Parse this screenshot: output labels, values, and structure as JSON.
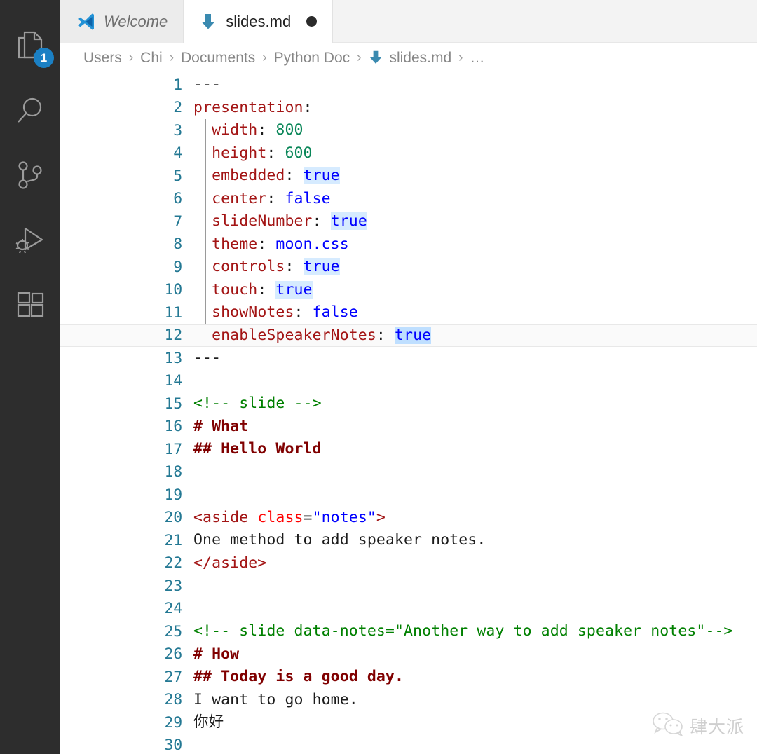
{
  "activity_bar": {
    "items": [
      {
        "name": "explorer",
        "icon": "files-icon",
        "badge": "1"
      },
      {
        "name": "search",
        "icon": "search-icon",
        "badge": null
      },
      {
        "name": "source-control",
        "icon": "source-control-icon",
        "badge": null
      },
      {
        "name": "run-and-debug",
        "icon": "run-debug-icon",
        "badge": null
      },
      {
        "name": "extensions",
        "icon": "extensions-icon",
        "badge": null
      }
    ]
  },
  "tabs": [
    {
      "label": "Welcome",
      "icon": "vscode-logo-icon",
      "active": false,
      "dirty": false
    },
    {
      "label": "slides.md",
      "icon": "markdown-file-icon",
      "active": true,
      "dirty": true
    }
  ],
  "breadcrumb": {
    "separator": "›",
    "items": [
      {
        "label": "Users",
        "icon": null
      },
      {
        "label": "Chi",
        "icon": null
      },
      {
        "label": "Documents",
        "icon": null
      },
      {
        "label": "Python Doc",
        "icon": null
      },
      {
        "label": "slides.md",
        "icon": "markdown-file-icon"
      },
      {
        "label": "…",
        "icon": null
      }
    ]
  },
  "editor": {
    "language": "markdown",
    "current_line": 12,
    "lines": [
      {
        "n": "1",
        "tokens": [
          {
            "t": "---",
            "c": "t-dash"
          }
        ]
      },
      {
        "n": "2",
        "tokens": [
          {
            "t": "presentation",
            "c": "t-key"
          },
          {
            "t": ":",
            "c": "t-punct"
          }
        ]
      },
      {
        "n": "3",
        "tokens": [
          {
            "t": "  ",
            "c": "t-plain"
          },
          {
            "t": "width",
            "c": "t-key"
          },
          {
            "t": ": ",
            "c": "t-punct"
          },
          {
            "t": "800",
            "c": "t-num"
          }
        ]
      },
      {
        "n": "4",
        "tokens": [
          {
            "t": "  ",
            "c": "t-plain"
          },
          {
            "t": "height",
            "c": "t-key"
          },
          {
            "t": ": ",
            "c": "t-punct"
          },
          {
            "t": "600",
            "c": "t-num"
          }
        ]
      },
      {
        "n": "5",
        "tokens": [
          {
            "t": "  ",
            "c": "t-plain"
          },
          {
            "t": "embedded",
            "c": "t-key"
          },
          {
            "t": ": ",
            "c": "t-punct"
          },
          {
            "t": "true",
            "c": "t-bool hl"
          }
        ]
      },
      {
        "n": "6",
        "tokens": [
          {
            "t": "  ",
            "c": "t-plain"
          },
          {
            "t": "center",
            "c": "t-key"
          },
          {
            "t": ": ",
            "c": "t-punct"
          },
          {
            "t": "false",
            "c": "t-bool"
          }
        ]
      },
      {
        "n": "7",
        "tokens": [
          {
            "t": "  ",
            "c": "t-plain"
          },
          {
            "t": "slideNumber",
            "c": "t-key"
          },
          {
            "t": ": ",
            "c": "t-punct"
          },
          {
            "t": "true",
            "c": "t-bool hl"
          }
        ]
      },
      {
        "n": "8",
        "tokens": [
          {
            "t": "  ",
            "c": "t-plain"
          },
          {
            "t": "theme",
            "c": "t-key"
          },
          {
            "t": ": ",
            "c": "t-punct"
          },
          {
            "t": "moon.css",
            "c": "t-str"
          }
        ]
      },
      {
        "n": "9",
        "tokens": [
          {
            "t": "  ",
            "c": "t-plain"
          },
          {
            "t": "controls",
            "c": "t-key"
          },
          {
            "t": ": ",
            "c": "t-punct"
          },
          {
            "t": "true",
            "c": "t-bool hl"
          }
        ]
      },
      {
        "n": "10",
        "tokens": [
          {
            "t": "  ",
            "c": "t-plain"
          },
          {
            "t": "touch",
            "c": "t-key"
          },
          {
            "t": ": ",
            "c": "t-punct"
          },
          {
            "t": "true",
            "c": "t-bool hl"
          }
        ]
      },
      {
        "n": "11",
        "tokens": [
          {
            "t": "  ",
            "c": "t-plain"
          },
          {
            "t": "showNotes",
            "c": "t-key"
          },
          {
            "t": ": ",
            "c": "t-punct"
          },
          {
            "t": "false",
            "c": "t-bool"
          }
        ]
      },
      {
        "n": "12",
        "tokens": [
          {
            "t": "  ",
            "c": "t-plain"
          },
          {
            "t": "enableSpeakerNotes",
            "c": "t-key"
          },
          {
            "t": ": ",
            "c": "t-punct"
          },
          {
            "t": "true",
            "c": "t-bool hl-strong"
          }
        ]
      },
      {
        "n": "13",
        "tokens": [
          {
            "t": "---",
            "c": "t-dash"
          }
        ]
      },
      {
        "n": "14",
        "tokens": []
      },
      {
        "n": "15",
        "tokens": [
          {
            "t": "<!-- slide -->",
            "c": "t-comment"
          }
        ]
      },
      {
        "n": "16",
        "tokens": [
          {
            "t": "# What",
            "c": "t-head"
          }
        ]
      },
      {
        "n": "17",
        "tokens": [
          {
            "t": "## Hello World",
            "c": "t-head"
          }
        ]
      },
      {
        "n": "18",
        "tokens": []
      },
      {
        "n": "19",
        "tokens": []
      },
      {
        "n": "20",
        "tokens": [
          {
            "t": "<aside ",
            "c": "t-tag"
          },
          {
            "t": "class",
            "c": "t-attr"
          },
          {
            "t": "=",
            "c": "t-punct"
          },
          {
            "t": "\"notes\"",
            "c": "t-str"
          },
          {
            "t": ">",
            "c": "t-tag"
          }
        ]
      },
      {
        "n": "21",
        "tokens": [
          {
            "t": "One method to add speaker notes.",
            "c": "t-plain"
          }
        ]
      },
      {
        "n": "22",
        "tokens": [
          {
            "t": "</aside>",
            "c": "t-tag"
          }
        ]
      },
      {
        "n": "23",
        "tokens": []
      },
      {
        "n": "24",
        "tokens": []
      },
      {
        "n": "25",
        "tokens": [
          {
            "t": "<!-- slide data-notes=\"Another way to add speaker notes\"-->",
            "c": "t-comment"
          }
        ]
      },
      {
        "n": "26",
        "tokens": [
          {
            "t": "# How",
            "c": "t-head"
          }
        ]
      },
      {
        "n": "27",
        "tokens": [
          {
            "t": "## Today is a good day.",
            "c": "t-head"
          }
        ]
      },
      {
        "n": "28",
        "tokens": [
          {
            "t": "I want to go home.",
            "c": "t-plain"
          }
        ]
      },
      {
        "n": "29",
        "tokens": [
          {
            "t": "你好",
            "c": "t-plain"
          }
        ]
      },
      {
        "n": "30",
        "tokens": []
      }
    ]
  },
  "watermark": {
    "icon": "wechat-icon",
    "text": "肆大派"
  },
  "colors": {
    "activity_bar_bg": "#2d2d2d",
    "tab_bar_bg": "#f3f3f3",
    "active_tab_bg": "#ffffff",
    "inactive_tab_bg": "#ececec",
    "editor_bg": "#ffffff",
    "line_number": "#237893",
    "badge": "#1b80c4",
    "key": "#a31515",
    "number": "#098658",
    "boolean": "#0000ff",
    "comment": "#008000",
    "heading": "#800000",
    "attribute": "#ff0000",
    "find_match": "#d6ebff",
    "current_find_match": "#bfdfff",
    "current_line_bg": "#fafafa"
  }
}
